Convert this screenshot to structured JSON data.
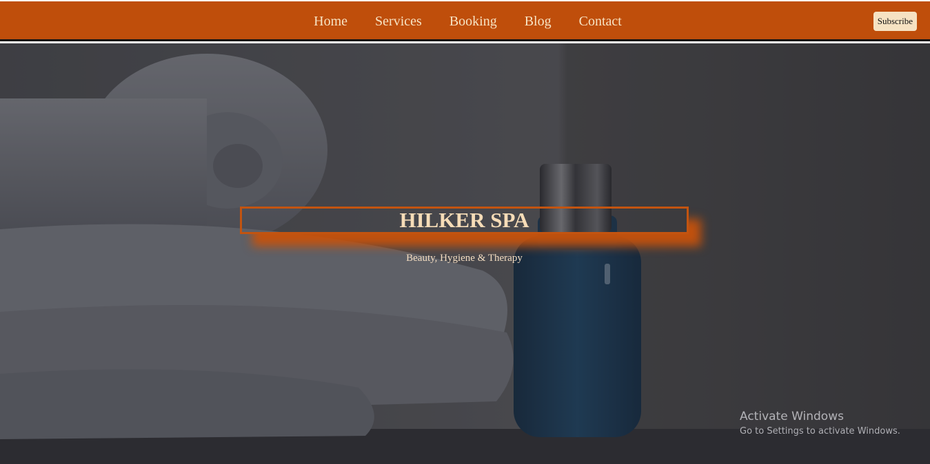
{
  "nav": {
    "links": [
      "Home",
      "Services",
      "Booking",
      "Blog",
      "Contact"
    ],
    "subscribe_label": "Subscribe"
  },
  "hero": {
    "title": "HILKER SPA",
    "subtitle": "Beauty, Hygiene & Therapy",
    "image_icon": "spa-towels-bottle-photo"
  },
  "watermark": {
    "title": "Activate Windows",
    "subtitle": "Go to Settings to activate Windows."
  },
  "colors": {
    "nav_bg": "#bf4e0b",
    "accent": "#c35410",
    "title_text": "#f6dcb7",
    "button_bg": "#f6e2c2"
  }
}
